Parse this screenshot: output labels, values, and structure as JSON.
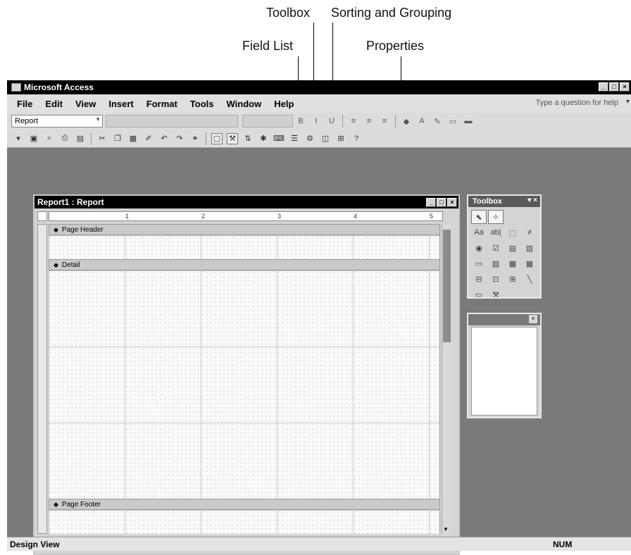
{
  "callouts": {
    "toolbox": "Toolbox",
    "sorting_grouping": "Sorting and Grouping",
    "field_list": "Field List",
    "properties": "Properties"
  },
  "app": {
    "title": "Microsoft Access",
    "window_buttons": [
      "_",
      "□",
      "×"
    ]
  },
  "menu": {
    "items": [
      "File",
      "Edit",
      "View",
      "Insert",
      "Format",
      "Tools",
      "Window",
      "Help"
    ],
    "help_placeholder": "Type a question for help"
  },
  "format_bar": {
    "object_combo": "Report"
  },
  "report_window": {
    "title": "Report1 : Report",
    "ruler_ticks": [
      "1",
      "2",
      "3",
      "4",
      "5"
    ],
    "sections": {
      "page_header": "Page Header",
      "detail": "Detail",
      "page_footer": "Page Footer"
    }
  },
  "toolbox_panel": {
    "title": "Toolbox",
    "tools": [
      "select-pointer",
      "wizard",
      "label",
      "text-box",
      "option-group",
      "toggle",
      "option",
      "check",
      "combo",
      "list",
      "command",
      "image",
      "unbound-frame",
      "bound-frame",
      "page-break",
      "tab",
      "subform",
      "line",
      "rectangle",
      "more"
    ]
  },
  "statusbar": {
    "mode": "Design View",
    "num": "NUM"
  }
}
